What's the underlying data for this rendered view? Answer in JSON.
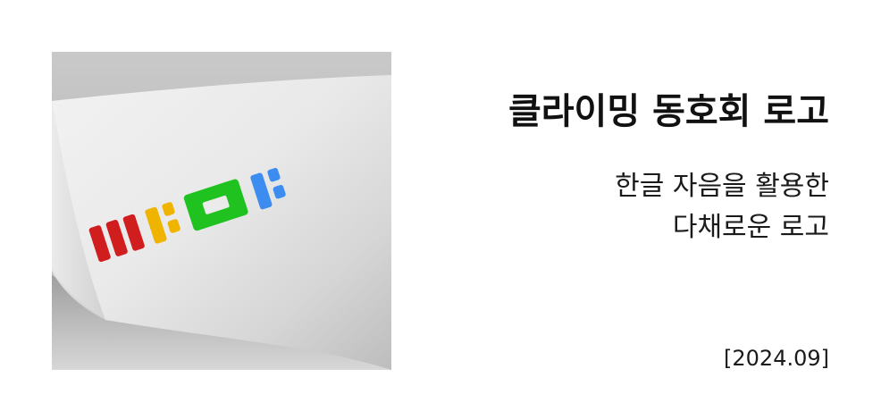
{
  "title": "클라이밍 동호회 로고",
  "subtitle": {
    "line1": "한글 자음을 활용한",
    "line2": "다채로운 로고"
  },
  "date": "[2024.09]",
  "logo": {
    "colors": {
      "red": "#d01e1e",
      "yellow": "#efb400",
      "green": "#1fc21f",
      "blue": "#3d8cf0"
    }
  }
}
